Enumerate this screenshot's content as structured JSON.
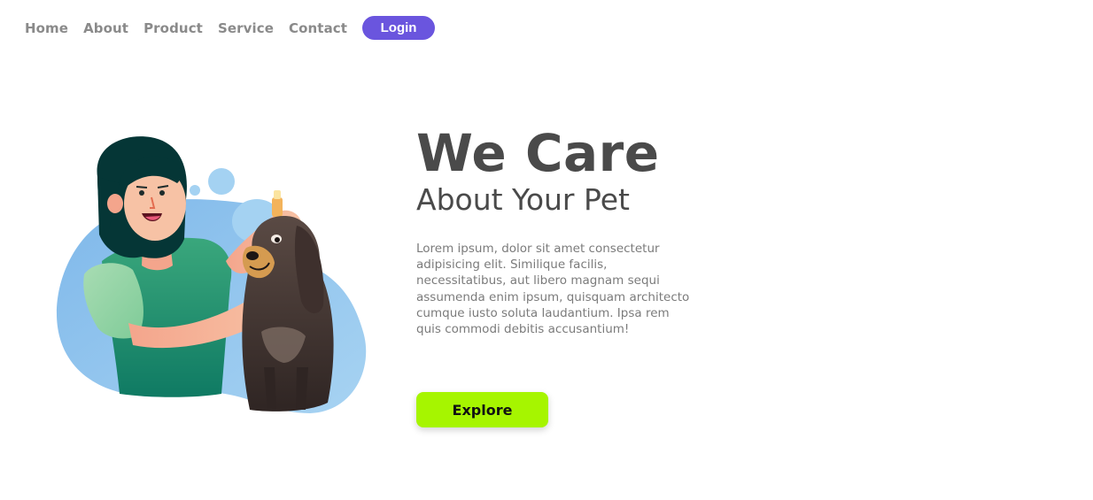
{
  "nav": {
    "links": [
      {
        "label": "Home"
      },
      {
        "label": "About"
      },
      {
        "label": "Product"
      },
      {
        "label": "Service"
      },
      {
        "label": "Contact"
      }
    ],
    "login_label": "Login"
  },
  "hero": {
    "title": "We Care",
    "subtitle": "About Your Pet",
    "description": "Lorem ipsum, dolor sit amet consectetur adipisicing elit. Similique facilis, necessitatibus, aut libero magnam sequi assumenda enim ipsum, quisquam architecto cumque iusto soluta laudantium. Ipsa rem quis commodi debitis accusantium!",
    "cta_label": "Explore"
  },
  "colors": {
    "login_bg": "#6a55de",
    "cta_bg": "#a6f500",
    "heading": "#4a4a4a",
    "body_text": "#7b7b7b",
    "nav_text": "#8a8a8a"
  },
  "illustration": {
    "icon": "woman-giving-dog-eye-drops-illustration"
  }
}
